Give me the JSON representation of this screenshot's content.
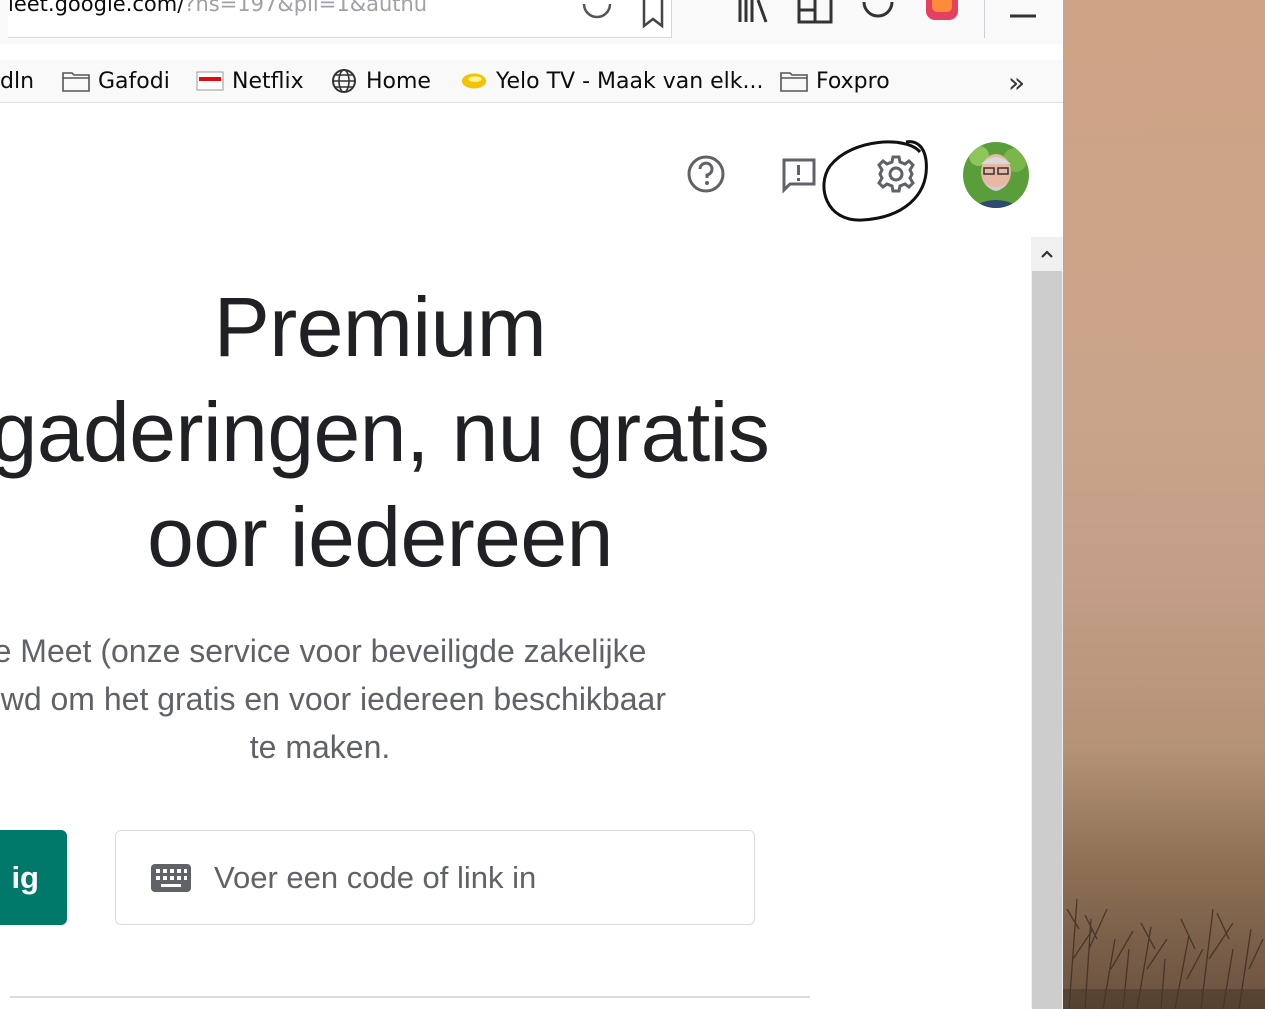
{
  "browser": {
    "url_main": "ieet.google.com/",
    "url_query": "?hs=197&pli=1&authu",
    "bookmarks": [
      {
        "label": "dln",
        "icon": "none"
      },
      {
        "label": "Gafodi",
        "icon": "folder-icon"
      },
      {
        "label": "Netflix",
        "icon": "netflix-icon"
      },
      {
        "label": "Home",
        "icon": "globe-icon"
      },
      {
        "label": "Yelo TV - Maak van elk...",
        "icon": "yelo-icon"
      },
      {
        "label": "Foxpro",
        "icon": "folder-icon"
      }
    ],
    "overflow_label": "»"
  },
  "header": {
    "icons": [
      "help-icon",
      "feedback-icon",
      "settings-icon",
      "avatar"
    ]
  },
  "main": {
    "headline": "Premium\ngaderingen, nu gratis\noor iedereen",
    "subtext": "e Meet (onze service voor beveiligde zakelijke\n:uwd om het gratis en voor iedereen beschikbaar\nte maken.",
    "new_meeting_label": "ig",
    "code_placeholder": "Voer een code of link in"
  },
  "colors": {
    "accent": "#00796b",
    "text": "#202124",
    "subtext": "#5f6368"
  }
}
